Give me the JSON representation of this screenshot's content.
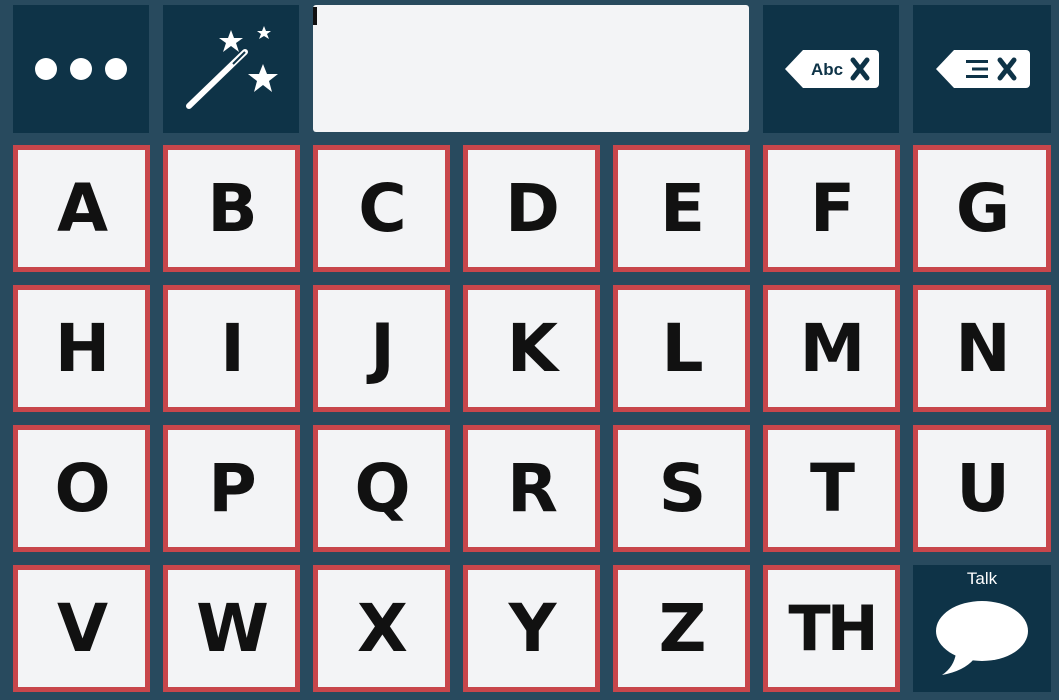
{
  "toolbar": {
    "more_icon": "more-dots-icon",
    "predict_icon": "magic-wand-icon",
    "clear_word_label": "Abc",
    "clear_word_icon": "clear-word-icon",
    "clear_all_icon": "clear-all-icon"
  },
  "message": {
    "text": ""
  },
  "keys": [
    {
      "label": "A"
    },
    {
      "label": "B"
    },
    {
      "label": "C"
    },
    {
      "label": "D"
    },
    {
      "label": "E"
    },
    {
      "label": "F"
    },
    {
      "label": "G"
    },
    {
      "label": "H"
    },
    {
      "label": "I"
    },
    {
      "label": "J"
    },
    {
      "label": "K"
    },
    {
      "label": "L"
    },
    {
      "label": "M"
    },
    {
      "label": "N"
    },
    {
      "label": "O"
    },
    {
      "label": "P"
    },
    {
      "label": "Q"
    },
    {
      "label": "R"
    },
    {
      "label": "S"
    },
    {
      "label": "T"
    },
    {
      "label": "U"
    },
    {
      "label": "V"
    },
    {
      "label": "W"
    },
    {
      "label": "X"
    },
    {
      "label": "Y"
    },
    {
      "label": "Z"
    },
    {
      "label": "TH"
    }
  ],
  "talk": {
    "label": "Talk",
    "icon": "speech-bubble-icon"
  },
  "colors": {
    "background": "#284a5e",
    "dark_cell": "#0e3347",
    "key_face": "#f3f4f6",
    "key_border": "#c8464b"
  }
}
